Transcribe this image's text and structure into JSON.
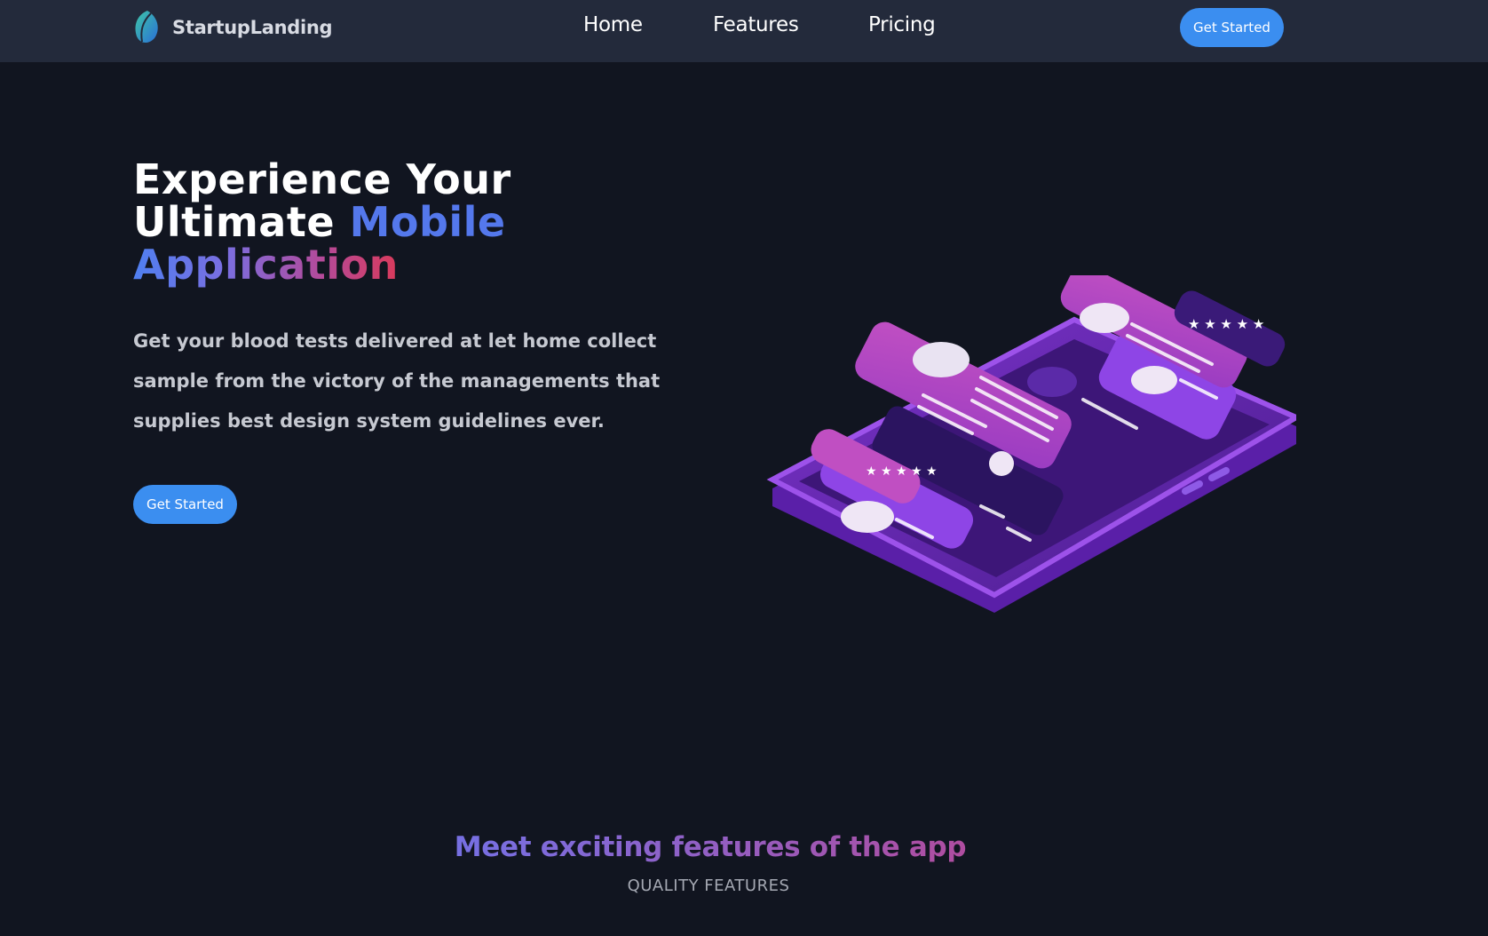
{
  "nav": {
    "brand": "StartupLanding",
    "links": [
      "Home",
      "Features",
      "Pricing"
    ],
    "cta_label": "Get Started"
  },
  "hero": {
    "title_line1": "Experience Your",
    "title_line2_plain": "Ultimate",
    "title_line2_accent": "Mobile",
    "title_line3": "Application",
    "description": "Get your blood tests delivered at let home collect sample from the victory of the managements that supplies best design system guidelines ever.",
    "cta_label": "Get Started"
  },
  "features": {
    "title": "Meet exciting features of the app",
    "subtitle": "QUALITY FEATURES"
  },
  "colors": {
    "background": "#111520",
    "navbar": "#232a3b",
    "accent_button": "#3b8ef0",
    "gradient_blue": "#4f7ff0",
    "gradient_red": "#d93a5b"
  }
}
